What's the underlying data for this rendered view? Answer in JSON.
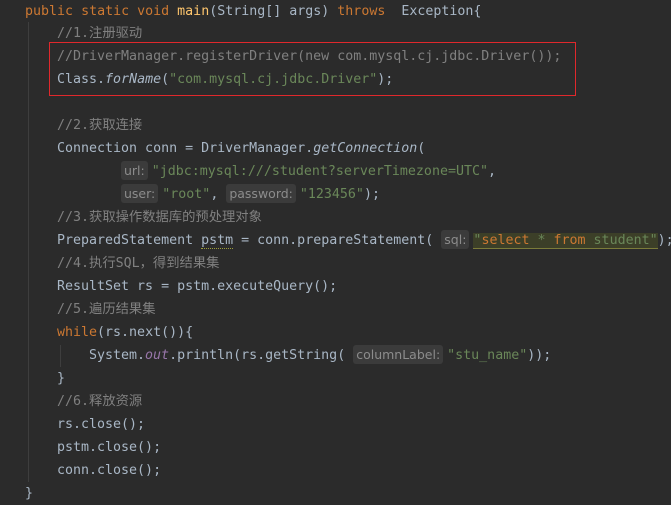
{
  "code": {
    "l0": {
      "kw_public": "public",
      "kw_static": "static",
      "kw_void": "void",
      "method": "main",
      "params": "(String[] args) ",
      "kw_throws": "throws",
      "exc": " Exception{"
    },
    "l1": {
      "comment": "//1.注册驱动"
    },
    "l2": {
      "comment": "//DriverManager.registerDriver(new com.mysql.cj.jdbc.Driver());"
    },
    "l3": {
      "pre": "Class.",
      "method": "forName",
      "open": "(",
      "str": "\"com.mysql.cj.jdbc.Driver\"",
      "close": ");"
    },
    "l4": {
      "comment": "//2.获取连接"
    },
    "l5": {
      "pre": "Connection conn = DriverManager.",
      "method": "getConnection",
      "open": "("
    },
    "l6": {
      "hint": "url:",
      "str": "\"jdbc:mysql:///student?serverTimezone=UTC\"",
      "tail": ","
    },
    "l7": {
      "hint1": "user:",
      "str1": "\"root\"",
      "sep": ", ",
      "hint2": "password:",
      "str2": "\"123456\"",
      "tail": ");"
    },
    "l8": {
      "comment": "//3.获取操作数据库的预处理对象"
    },
    "l9": {
      "pre": "PreparedStatement ",
      "var": "pstm",
      "mid": " = conn.prepareStatement( ",
      "hint": "sql:",
      "q1": "\"",
      "kw1": "select",
      "s2": " * ",
      "kw2": "from",
      "s3": " student",
      "q2": "\"",
      "tail": ");"
    },
    "l10": {
      "comment": "//4.执行SQL，得到结果集"
    },
    "l11": {
      "text": "ResultSet rs = pstm.executeQuery();"
    },
    "l12": {
      "comment": "//5.遍历结果集"
    },
    "l13": {
      "kw": "while",
      "rest": "(rs.next()){"
    },
    "l14": {
      "pre": "System.",
      "field": "out",
      "mid": ".println(rs.getString( ",
      "hint": "columnLabel:",
      "str": "\"stu_name\"",
      "tail": "));"
    },
    "l15": {
      "text": "}"
    },
    "l16": {
      "comment": "//6.释放资源"
    },
    "l17": {
      "text": "rs.close();"
    },
    "l18": {
      "text": "pstm.close();"
    },
    "l19": {
      "text": "conn.close();"
    },
    "l20": {
      "text": "}"
    }
  },
  "colors": {
    "background": "#2b2b2b",
    "keyword": "#cc7832",
    "string": "#6a8759",
    "comment": "#808080",
    "method": "#ffc66d",
    "highlight_box": "#e0282c"
  }
}
